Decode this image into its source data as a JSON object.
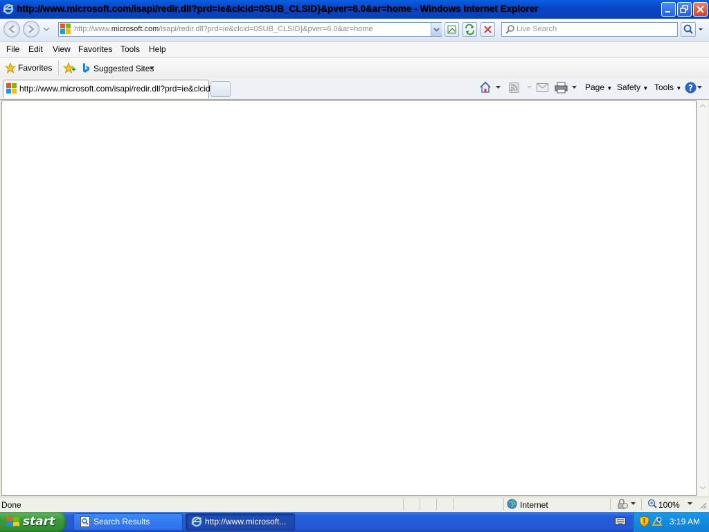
{
  "window": {
    "title": "http://www.microsoft.com/isapi/redir.dll?prd=ie&clcid=0SUB_CLSID}&pver=6.0&ar=home - Windows Internet Explorer"
  },
  "address_bar": {
    "url_prefix": "http://www.",
    "url_domain": "microsoft.com",
    "url_rest": "/isapi/redir.dll?prd=ie&clcid=0SUB_CLSID}&pver=6.0&ar=home"
  },
  "search": {
    "placeholder": "Live Search"
  },
  "menu": {
    "items": [
      "File",
      "Edit",
      "View",
      "Favorites",
      "Tools",
      "Help"
    ]
  },
  "favorites_bar": {
    "favorites_label": "Favorites",
    "suggested_sites_label": "Suggested Sites"
  },
  "tabs": [
    {
      "label": "http://www.microsoft.com/isapi/redir.dll?prd=ie&clcid..."
    }
  ],
  "command_bar": {
    "page_label": "Page",
    "safety_label": "Safety",
    "tools_label": "Tools"
  },
  "status_bar": {
    "status_text": "Done",
    "zone_label": "Internet",
    "zoom_label": "100%"
  },
  "taskbar": {
    "start_label": "start",
    "tasks": [
      {
        "label": "Search Results"
      },
      {
        "label": "http://www.microsoft..."
      }
    ],
    "clock": "3:19 AM"
  },
  "colors": {
    "title_bar": "#0A5FE0",
    "taskbar": "#245EDB",
    "start_button": "#3B9A3B",
    "tray": "#1898EA"
  }
}
